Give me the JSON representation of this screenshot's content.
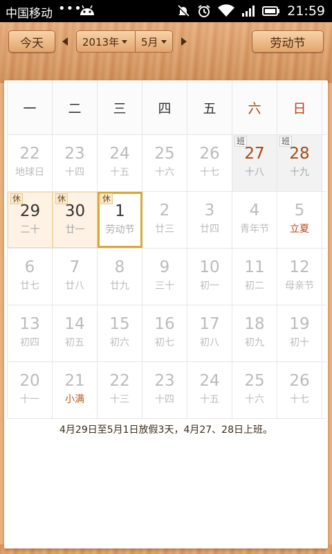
{
  "status_bar": {
    "carrier": "中国移动",
    "dots": "•••",
    "time": "21:59"
  },
  "toolbar": {
    "today_label": "今天",
    "year_label": "2013年",
    "month_label": "5月",
    "holiday_label": "劳动节"
  },
  "weekdays": [
    "一",
    "二",
    "三",
    "四",
    "五",
    "六",
    "日"
  ],
  "weeks": [
    [
      {
        "day": "22",
        "lunar": "地球日"
      },
      {
        "day": "23",
        "lunar": "十四"
      },
      {
        "day": "24",
        "lunar": "十五"
      },
      {
        "day": "25",
        "lunar": "十六"
      },
      {
        "day": "26",
        "lunar": "十七"
      },
      {
        "day": "27",
        "lunar": "十八",
        "badge": "班"
      },
      {
        "day": "28",
        "lunar": "十九",
        "badge": "班"
      }
    ],
    [
      {
        "day": "29",
        "lunar": "二十",
        "badge": "休"
      },
      {
        "day": "30",
        "lunar": "廿一",
        "badge": "休"
      },
      {
        "day": "1",
        "lunar": "劳动节",
        "badge": "休"
      },
      {
        "day": "2",
        "lunar": "廿三"
      },
      {
        "day": "3",
        "lunar": "廿四"
      },
      {
        "day": "4",
        "lunar": "青年节"
      },
      {
        "day": "5",
        "lunar": "立夏"
      }
    ],
    [
      {
        "day": "6",
        "lunar": "廿七"
      },
      {
        "day": "7",
        "lunar": "廿八"
      },
      {
        "day": "8",
        "lunar": "廿九"
      },
      {
        "day": "9",
        "lunar": "三十"
      },
      {
        "day": "10",
        "lunar": "初一"
      },
      {
        "day": "11",
        "lunar": "初二"
      },
      {
        "day": "12",
        "lunar": "母亲节"
      }
    ],
    [
      {
        "day": "13",
        "lunar": "初四"
      },
      {
        "day": "14",
        "lunar": "初五"
      },
      {
        "day": "15",
        "lunar": "初六"
      },
      {
        "day": "16",
        "lunar": "初七"
      },
      {
        "day": "17",
        "lunar": "初八"
      },
      {
        "day": "18",
        "lunar": "初九"
      },
      {
        "day": "19",
        "lunar": "初十"
      }
    ],
    [
      {
        "day": "20",
        "lunar": "十一"
      },
      {
        "day": "21",
        "lunar": "小满"
      },
      {
        "day": "22",
        "lunar": "十三"
      },
      {
        "day": "23",
        "lunar": "十四"
      },
      {
        "day": "24",
        "lunar": "十五"
      },
      {
        "day": "25",
        "lunar": "十六"
      },
      {
        "day": "26",
        "lunar": "十七"
      }
    ]
  ],
  "holiday_note": "4月29日至5月1日放假3天，4月27、28日上班。",
  "colors": {
    "accent_festival": "#b8420e",
    "weekend_header": "#a84a10",
    "today_border": "#d8a838",
    "rest_fill": "#fdf2e3",
    "work_fill": "#f2f2f2"
  }
}
